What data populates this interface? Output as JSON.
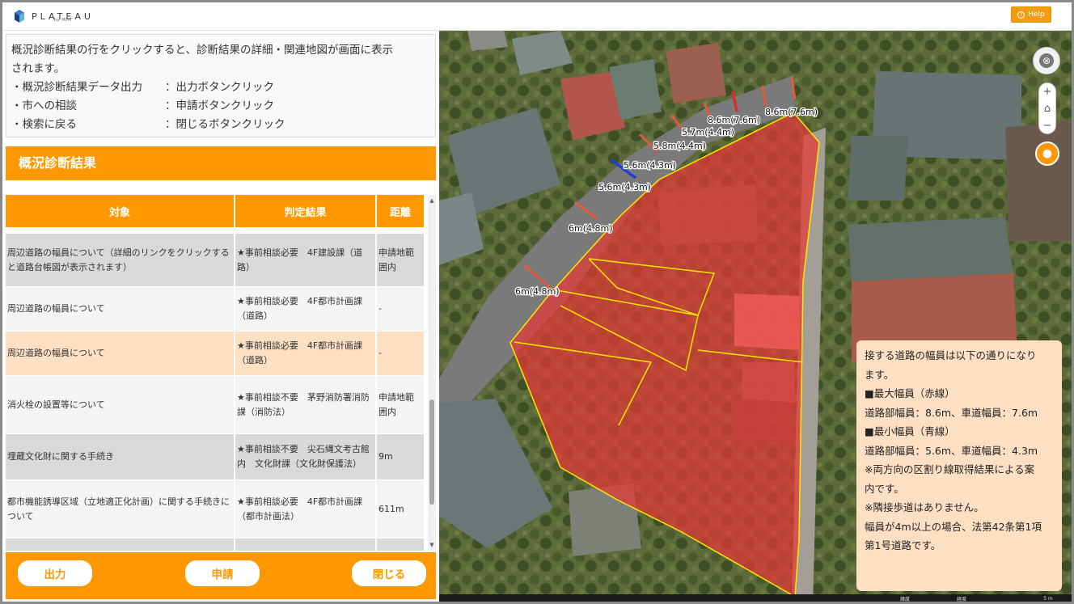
{
  "header": {
    "logo_text": "PLATEAU",
    "logo_sub": "by MLIT",
    "help_label": "Help"
  },
  "instructions": {
    "line1": "概況診断結果の行をクリックすると、診断結果の詳細・関連地図が画面に表示",
    "line2": "されます。",
    "items": [
      {
        "key": "・概況診断結果データ出力",
        "val": "：出力ボタンクリック"
      },
      {
        "key": "・市への相談",
        "val": "：申請ボタンクリック"
      },
      {
        "key": "・検索に戻る",
        "val": "：閉じるボタンクリック"
      }
    ]
  },
  "result": {
    "title": "概況診断結果",
    "headers": {
      "target": "対象",
      "judgement": "判定結果",
      "distance": "距離"
    },
    "rows": [
      {
        "target": "周辺道路の幅員について（詳細のリンクをクリックすると道路台帳図が表示されます）",
        "judgement": "★事前相談必要　4F建設課（道路）",
        "distance": "申請地範囲内"
      },
      {
        "target": "周辺道路の幅員について",
        "judgement": "★事前相談必要　4F都市計画課（道路）",
        "distance": "-"
      },
      {
        "target": "周辺道路の幅員について",
        "judgement": "★事前相談必要　4F都市計画課（道路）",
        "distance": "-"
      },
      {
        "target": "消火栓の設置等について",
        "judgement": "★事前相談不要　茅野消防署消防課（消防法）",
        "distance": "申請地範囲内"
      },
      {
        "target": "埋蔵文化財に関する手続き",
        "judgement": "★事前相談不要　尖石縄文考古館 内　文化財課（文化財保護法）",
        "distance": "9m"
      },
      {
        "target": "都市機能誘導区域（立地適正化計画）に関する手続きについて",
        "judgement": "★事前相談必要　4F都市計画課（都市計画法）",
        "distance": "611m"
      }
    ]
  },
  "buttons": {
    "output": "出力",
    "apply": "申請",
    "close": "閉じる"
  },
  "map": {
    "road_labels": [
      "8.6m(7.6m)",
      "8.6m(7.6m)",
      "5.7m(4.4m)",
      "5.8m(4.4m)",
      "5.6m(4.3m)",
      "5.6m(4.3m)",
      "6m(4.8m)",
      "6m(4.8m)"
    ],
    "info_lines": [
      "接する道路の幅員は以下の通りになり",
      "ます。",
      "■最大幅員（赤線）",
      "道路部幅員：8.6m、車道幅員：7.6m",
      "■最小幅員（青線）",
      "道路部幅員：5.6m、車道幅員：4.3m",
      "※両方向の区割り線取得結果による案",
      "内です。",
      "※隣接歩道はありません。",
      "幅員が4m以上の場合、法第42条第1項",
      "第1号道路です。"
    ],
    "zoom_in": "+",
    "home": "⌂",
    "zoom_out": "−",
    "coord_lat": "緯度",
    "coord_lon": "経度",
    "scale_label": "5 m",
    "colors": {
      "max_width": "#d32f2f",
      "min_width": "#1f3fd1",
      "parcel": "#e53935",
      "parcel_edge": "#ffe600"
    }
  }
}
